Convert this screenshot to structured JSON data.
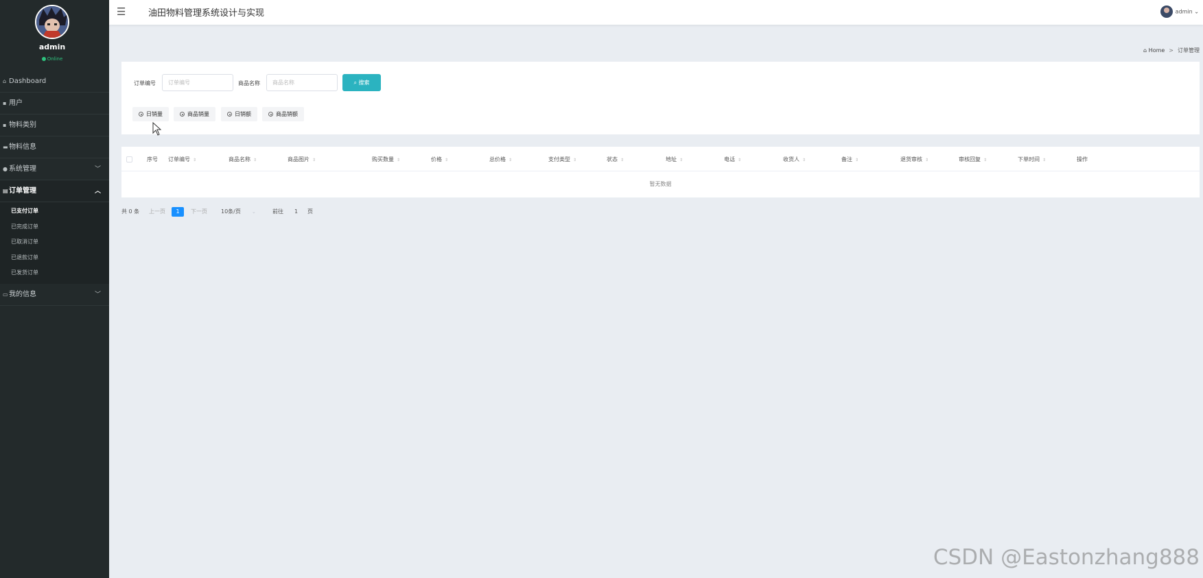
{
  "sidebar": {
    "user_name": "admin",
    "status": "Online",
    "items": [
      {
        "label": "Dashboard",
        "icon": "home-icon"
      },
      {
        "label": "用户",
        "icon": "grid-icon"
      },
      {
        "label": "物料类别",
        "icon": "grid-icon"
      },
      {
        "label": "物料信息",
        "icon": "card-icon"
      },
      {
        "label": "系统管理",
        "icon": "user-icon"
      },
      {
        "label": "订单管理",
        "icon": "list-icon"
      },
      {
        "label": "我的信息",
        "icon": "calendar-icon"
      }
    ],
    "submenu": [
      "已支付订单",
      "已完成订单",
      "已取消订单",
      "已退款订单",
      "已发货订单"
    ]
  },
  "header": {
    "title": "油田物料管理系统设计与实现",
    "user": "admin"
  },
  "breadcrumb": {
    "home": "Home",
    "separator": ">",
    "current": "订单管理"
  },
  "search": {
    "order_no_label": "订单编号",
    "order_no_placeholder": "订单编号",
    "product_label": "商品名称",
    "product_placeholder": "商品名称",
    "button": "搜索"
  },
  "stat_buttons": [
    "日销量",
    "商品销量",
    "日销额",
    "商品销额"
  ],
  "table": {
    "columns": [
      "序号",
      "订单编号",
      "商品名称",
      "商品图片",
      "购买数量",
      "价格",
      "总价格",
      "支付类型",
      "状态",
      "地址",
      "电话",
      "收货人",
      "备注",
      "退货审核",
      "审核回复",
      "下单时间",
      "操作"
    ],
    "empty_text": "暂无数据"
  },
  "pagination": {
    "total": "共 0 条",
    "prev": "上一页",
    "current_page": "1",
    "next": "下一页",
    "page_size": "10条/页",
    "goto_label": "前往",
    "goto_value": "1",
    "page_unit": "页"
  },
  "watermark": "CSDN @Eastonzhang888",
  "colors": {
    "sidebar_bg": "#232a2b",
    "accent": "#2bb3c0",
    "page_active": "#1890ff",
    "online": "#2ec27e"
  }
}
